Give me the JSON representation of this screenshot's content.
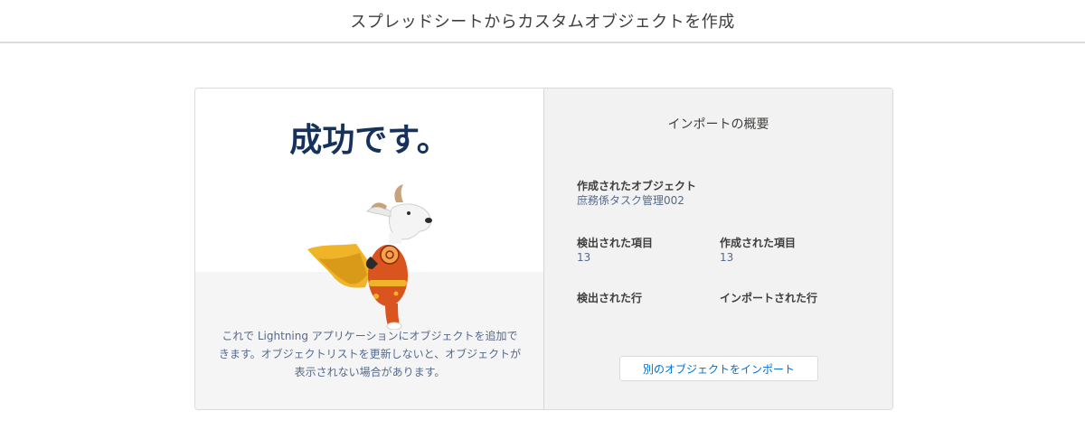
{
  "header": {
    "title": "スプレッドシートからカスタムオブジェクトを作成"
  },
  "left": {
    "heading": "成功です。",
    "message": "これで Lightning アプリケーションにオブジェクトを追加できます。オブジェクトリストを更新しないと、オブジェクトが表示されない場合があります。"
  },
  "summary": {
    "title": "インポートの概要",
    "created_object_label": "作成されたオブジェクト",
    "created_object_value": "庶務係タスク管理002",
    "detected_fields_label": "検出された項目",
    "detected_fields_value": "13",
    "created_fields_label": "作成された項目",
    "created_fields_value": "13",
    "detected_rows_label": "検出された行",
    "imported_rows_label": "インポートされた行",
    "import_another_button": "別のオブジェクトをインポート"
  },
  "colors": {
    "heading": "#16325c",
    "link": "#0070d2",
    "cape": "#f0b429",
    "suit": "#d9541e"
  }
}
